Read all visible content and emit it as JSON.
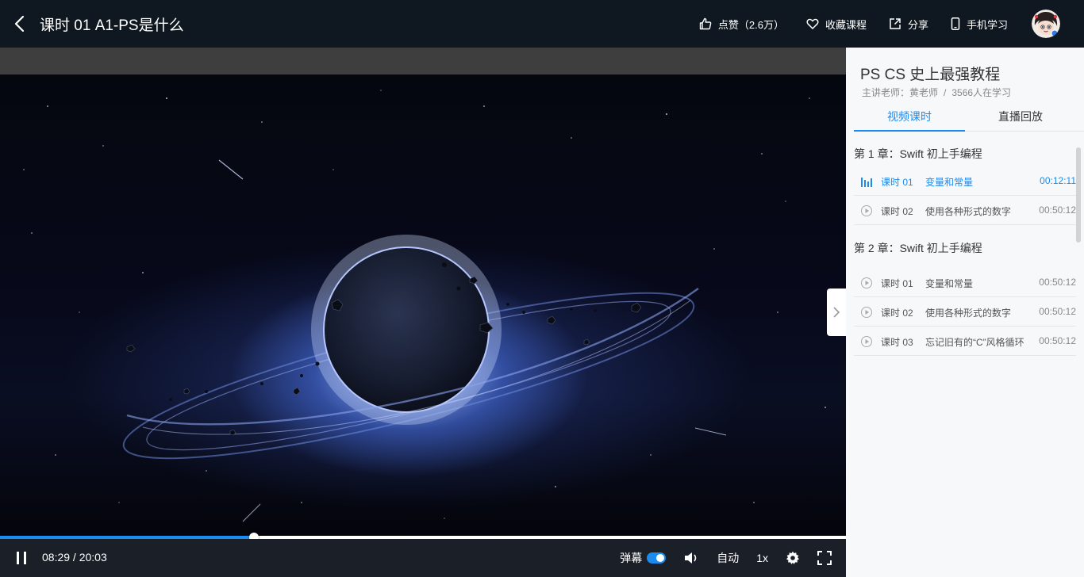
{
  "header": {
    "title": "课时 01 A1-PS是什么",
    "actions": [
      {
        "icon": "thumbs-up-icon",
        "label": "点赞（2.6万）"
      },
      {
        "icon": "heart-icon",
        "label": "收藏课程"
      },
      {
        "icon": "share-icon",
        "label": "分享"
      },
      {
        "icon": "mobile-icon",
        "label": "手机学习"
      }
    ]
  },
  "player": {
    "current_time": "08:29",
    "separator": " / ",
    "duration": "20:03",
    "progress": 0.3,
    "danmaku_label": "弹幕",
    "danmaku_on": true,
    "quality_label": "自动",
    "speed_label": "1x"
  },
  "sidebar": {
    "course_title": "PS CS 史上最强教程",
    "teacher": "主讲老师：黄老师",
    "meta_sep": "/",
    "learners": "3566人在学习",
    "tabs": [
      {
        "label": "视频课时",
        "active": true
      },
      {
        "label": "直播回放",
        "active": false
      }
    ],
    "chapters": [
      {
        "title": "第 1 章：Swift 初上手编程",
        "lessons": [
          {
            "num": "课时 01",
            "name": "变量和常量",
            "duration": "00:12:11",
            "active": true
          },
          {
            "num": "课时 02",
            "name": "使用各种形式的数字",
            "duration": "00:50:12",
            "active": false
          }
        ]
      },
      {
        "title": "第 2 章：Swift 初上手编程",
        "lessons": [
          {
            "num": "课时 01",
            "name": "变量和常量",
            "duration": "00:50:12",
            "active": false
          },
          {
            "num": "课时 02",
            "name": "使用各种形式的数字",
            "duration": "00:50:12",
            "active": false
          },
          {
            "num": "课时 03",
            "name": "忘记旧有的“C”风格循环",
            "duration": "00:50:12",
            "active": false
          }
        ]
      }
    ]
  },
  "colors": {
    "accent": "#1a8cf0",
    "topbar_bg": "#0f1820",
    "sidebar_bg": "#f7f8fa",
    "controls_bg": "#1b1f27"
  }
}
